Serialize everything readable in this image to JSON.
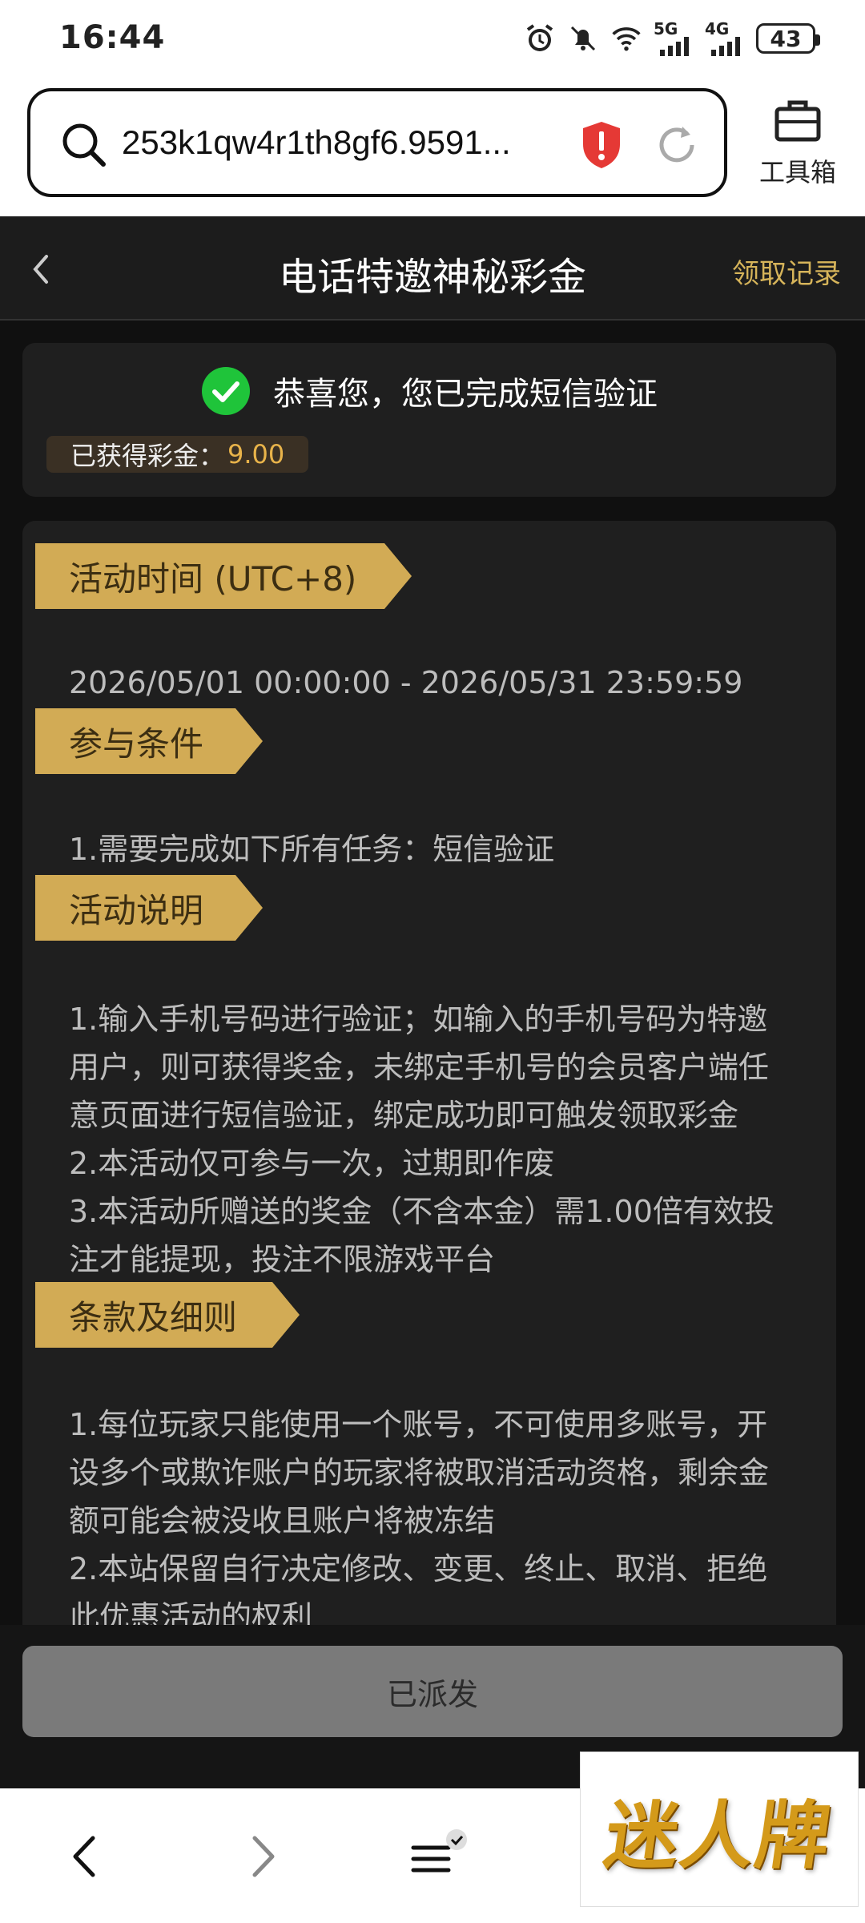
{
  "status_bar": {
    "time": "16:44",
    "network_5g": "5G",
    "network_4g": "4G",
    "battery": "43",
    "icons": [
      "alarm-icon",
      "mute-icon",
      "wifi-icon",
      "signal-5g-icon",
      "signal-4g-icon",
      "battery-icon"
    ]
  },
  "browser": {
    "url": "253k1qw4r1th8gf6.9591...",
    "toolbox_label": "工具箱"
  },
  "header": {
    "title": "电话特邀神秘彩金",
    "records_link": "领取记录"
  },
  "verify": {
    "message": "恭喜您，您已完成短信验证",
    "bonus_label": "已获得彩金：",
    "bonus_amount": "9.00"
  },
  "sections": {
    "time": {
      "title": "活动时间 (UTC+8)",
      "range": "2026/05/01 00:00:00 - 2026/05/31 23:59:59"
    },
    "conditions": {
      "title": "参与条件",
      "lines": [
        "1.需要完成如下所有任务：短信验证"
      ]
    },
    "description": {
      "title": "活动说明",
      "lines": [
        "1.输入手机号码进行验证；如输入的手机号码为特邀",
        "用户，则可获得奖金，未绑定手机号的会员客户端任",
        "意页面进行短信验证，绑定成功即可触发领取彩金",
        "2.本活动仅可参与一次，过期即作废",
        "3.本活动所赠送的奖金（不含本金）需1.00倍有效投",
        "注才能提现，投注不限游戏平台"
      ]
    },
    "terms": {
      "title": "条款及细则",
      "lines": [
        "1.每位玩家只能使用一个账号，不可使用多账号，开",
        "设多个或欺诈账户的玩家将被取消活动资格，剩余金",
        "额可能会被没收且账户将被冻结",
        "2.本站保留自行决定修改、变更、终止、取消、拒绝",
        "此优惠活动的权利"
      ]
    }
  },
  "dispatch_button": "已派发",
  "watermark_logo": "迷人牌",
  "colors": {
    "accent_gold": "#d2ab55",
    "bonus_amount": "#e8b34a",
    "check_green": "#1fc43a",
    "shield_red": "#e53935"
  }
}
